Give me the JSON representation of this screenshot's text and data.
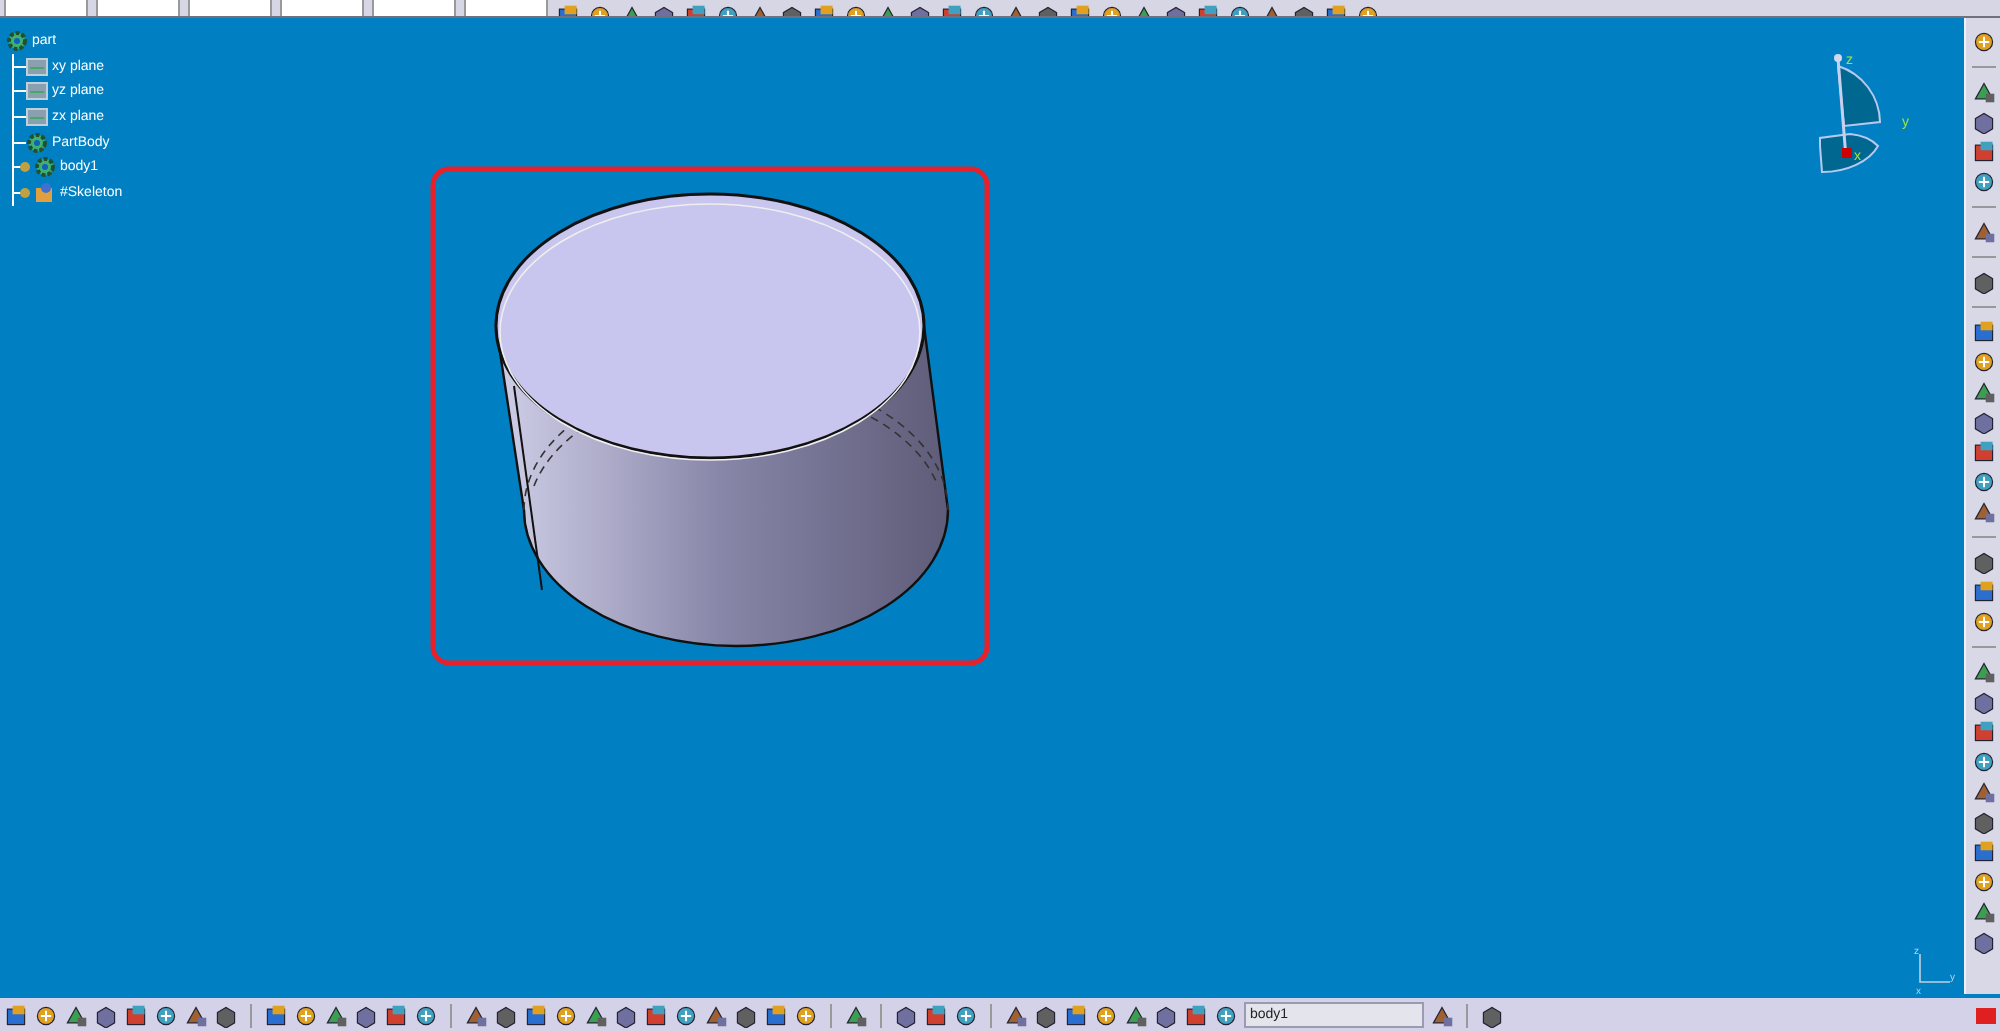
{
  "tree": {
    "label": "part",
    "children": [
      {
        "label": "xy plane",
        "kind": "plane",
        "expandable": false
      },
      {
        "label": "yz plane",
        "kind": "plane",
        "expandable": false
      },
      {
        "label": "zx plane",
        "kind": "plane",
        "expandable": false
      },
      {
        "label": "PartBody",
        "kind": "body",
        "expandable": false
      },
      {
        "label": "body1",
        "kind": "body",
        "expandable": true
      },
      {
        "label": "#Skeleton",
        "kind": "skeleton",
        "expandable": true
      }
    ]
  },
  "compass": {
    "axes": [
      "z",
      "y",
      "x"
    ]
  },
  "mini_axes": [
    "z",
    "y",
    "x"
  ],
  "bottom_toolbar": {
    "current_body": "body1"
  }
}
